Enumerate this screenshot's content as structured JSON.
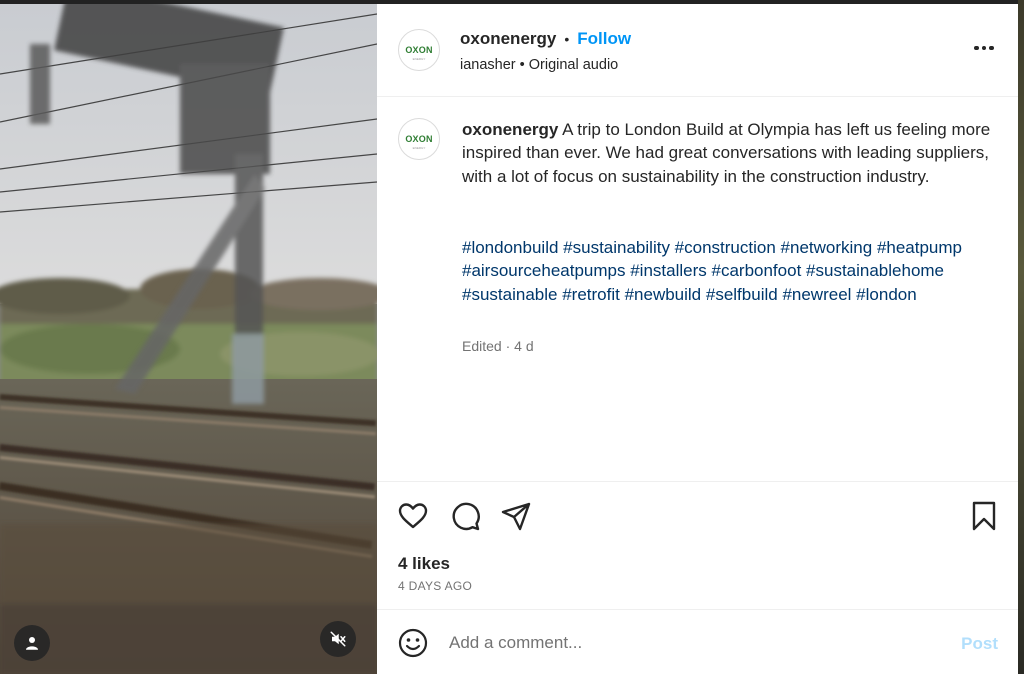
{
  "post": {
    "author": "oxonenergy",
    "follow_label": "Follow",
    "separator": "•",
    "audio_line": "ianasher • Original audio",
    "avatar_text": "OXON",
    "avatar_subtext": "ENERGY"
  },
  "caption": {
    "username": "oxonenergy",
    "text": " A trip to London Build at Olympia has left us feeling more inspired than ever. We had great conversations with leading suppliers, with a lot of focus on sustainability in the construction industry.",
    "hashtags": [
      "#londonbuild",
      "#sustainability",
      "#construction",
      "#networking",
      "#heatpump",
      "#airsourceheatpumps",
      "#installers",
      "#carbonfoot",
      "#sustainablehome",
      "#sustainable",
      "#retrofit",
      "#newbuild",
      "#selfbuild",
      "#newreel",
      "#london"
    ],
    "edited": "Edited · 4 d"
  },
  "engagement": {
    "likes": "4 likes",
    "time_ago": "4 DAYS AGO"
  },
  "comment": {
    "placeholder": "Add a comment...",
    "post_label": "Post"
  },
  "icons": {
    "tag": "user-tag-icon",
    "mute": "speaker-muted-icon",
    "more": "more-horizontal-icon",
    "like": "heart-icon",
    "comment": "speech-bubble-icon",
    "share": "paper-plane-icon",
    "save": "bookmark-icon",
    "emoji": "smiley-face-icon"
  },
  "colors": {
    "follow": "#0095f6",
    "hashtag": "#00376b",
    "post_disabled": "#b2dffc",
    "logo_green": "#2e7d32"
  }
}
